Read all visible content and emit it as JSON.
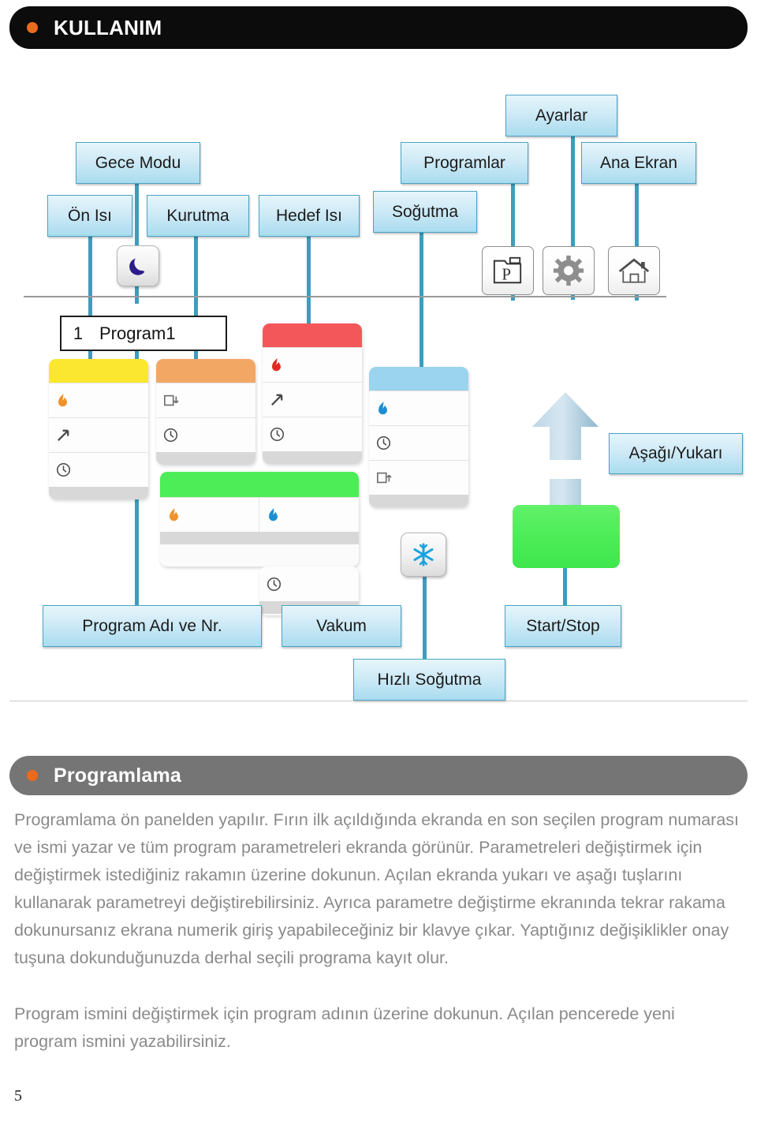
{
  "header": {
    "title": "KULLANIM",
    "dot_color": "#ec6a1e",
    "bg_color": "#0c0c0c"
  },
  "section": {
    "title": "Programlama",
    "dot_color": "#ec6a1e",
    "bg_color": "#757575"
  },
  "diagram": {
    "callouts": {
      "gece_modu": "Gece Modu",
      "on_isi": "Ön Isı",
      "kurutma": "Kurutma",
      "hedef_isi": "Hedef Isı",
      "sogutma": "Soğutma",
      "programlar": "Programlar",
      "ayarlar": "Ayarlar",
      "ana_ekran": "Ana Ekran",
      "asagi_yukari": "Aşağı/Yukarı",
      "program_adi_ve_nr": "Program Adı ve Nr.",
      "vakum": "Vakum",
      "hizli_sogutma": "Hızlı Soğutma",
      "start_stop": "Start/Stop"
    },
    "program_row": {
      "number": "1",
      "name": "Program1"
    },
    "card_colors": {
      "on_isi": "#fbe72f",
      "kurutma": "#f2a765",
      "hedef_isi": "#f4575a",
      "sogutma": "#9bd4ef",
      "vakum": "#4ded58",
      "start_stop": "#4ded58"
    },
    "icons": {
      "night_mode": "moon-icon",
      "programs": "folder-p-icon",
      "settings": "gear-icon",
      "home": "home-icon",
      "quick_cool": "snowflake-icon",
      "flame_orange": "flame-icon",
      "flame_red": "flame-icon",
      "flame_blue": "flame-icon",
      "ramp": "ramp-arrow-icon",
      "clock": "clock-icon",
      "vacuum_in": "vacuum-in-icon",
      "vacuum_out": "vacuum-out-icon",
      "up_arrow": "arrow-up-icon",
      "down_arrow": "arrow-down-icon"
    },
    "leader_color": "#3d9dbd"
  },
  "body": {
    "paragraph1": "Programlama ön panelden yapılır. Fırın ilk açıldığında ekranda en son seçilen program numarası ve ismi yazar ve tüm program parametreleri ekranda görünür. Parametreleri değiştirmek için değiştirmek istediğiniz rakamın üzerine dokunun. Açılan ekranda yukarı ve aşağı tuşlarını kullanarak parametreyi değiştirebilirsiniz. Ayrıca parametre değiştirme ekranında tekrar rakama dokunursanız ekrana numerik giriş yapabileceğiniz bir klavye çıkar. Yaptığınız değişiklikler onay tuşuna dokunduğunuzda derhal seçili programa kayıt olur.",
    "paragraph2": "Program ismini değiştirmek için program adının üzerine dokunun. Açılan pencerede yeni program ismini yazabilirsiniz."
  },
  "footer": {
    "page_number": "5"
  }
}
